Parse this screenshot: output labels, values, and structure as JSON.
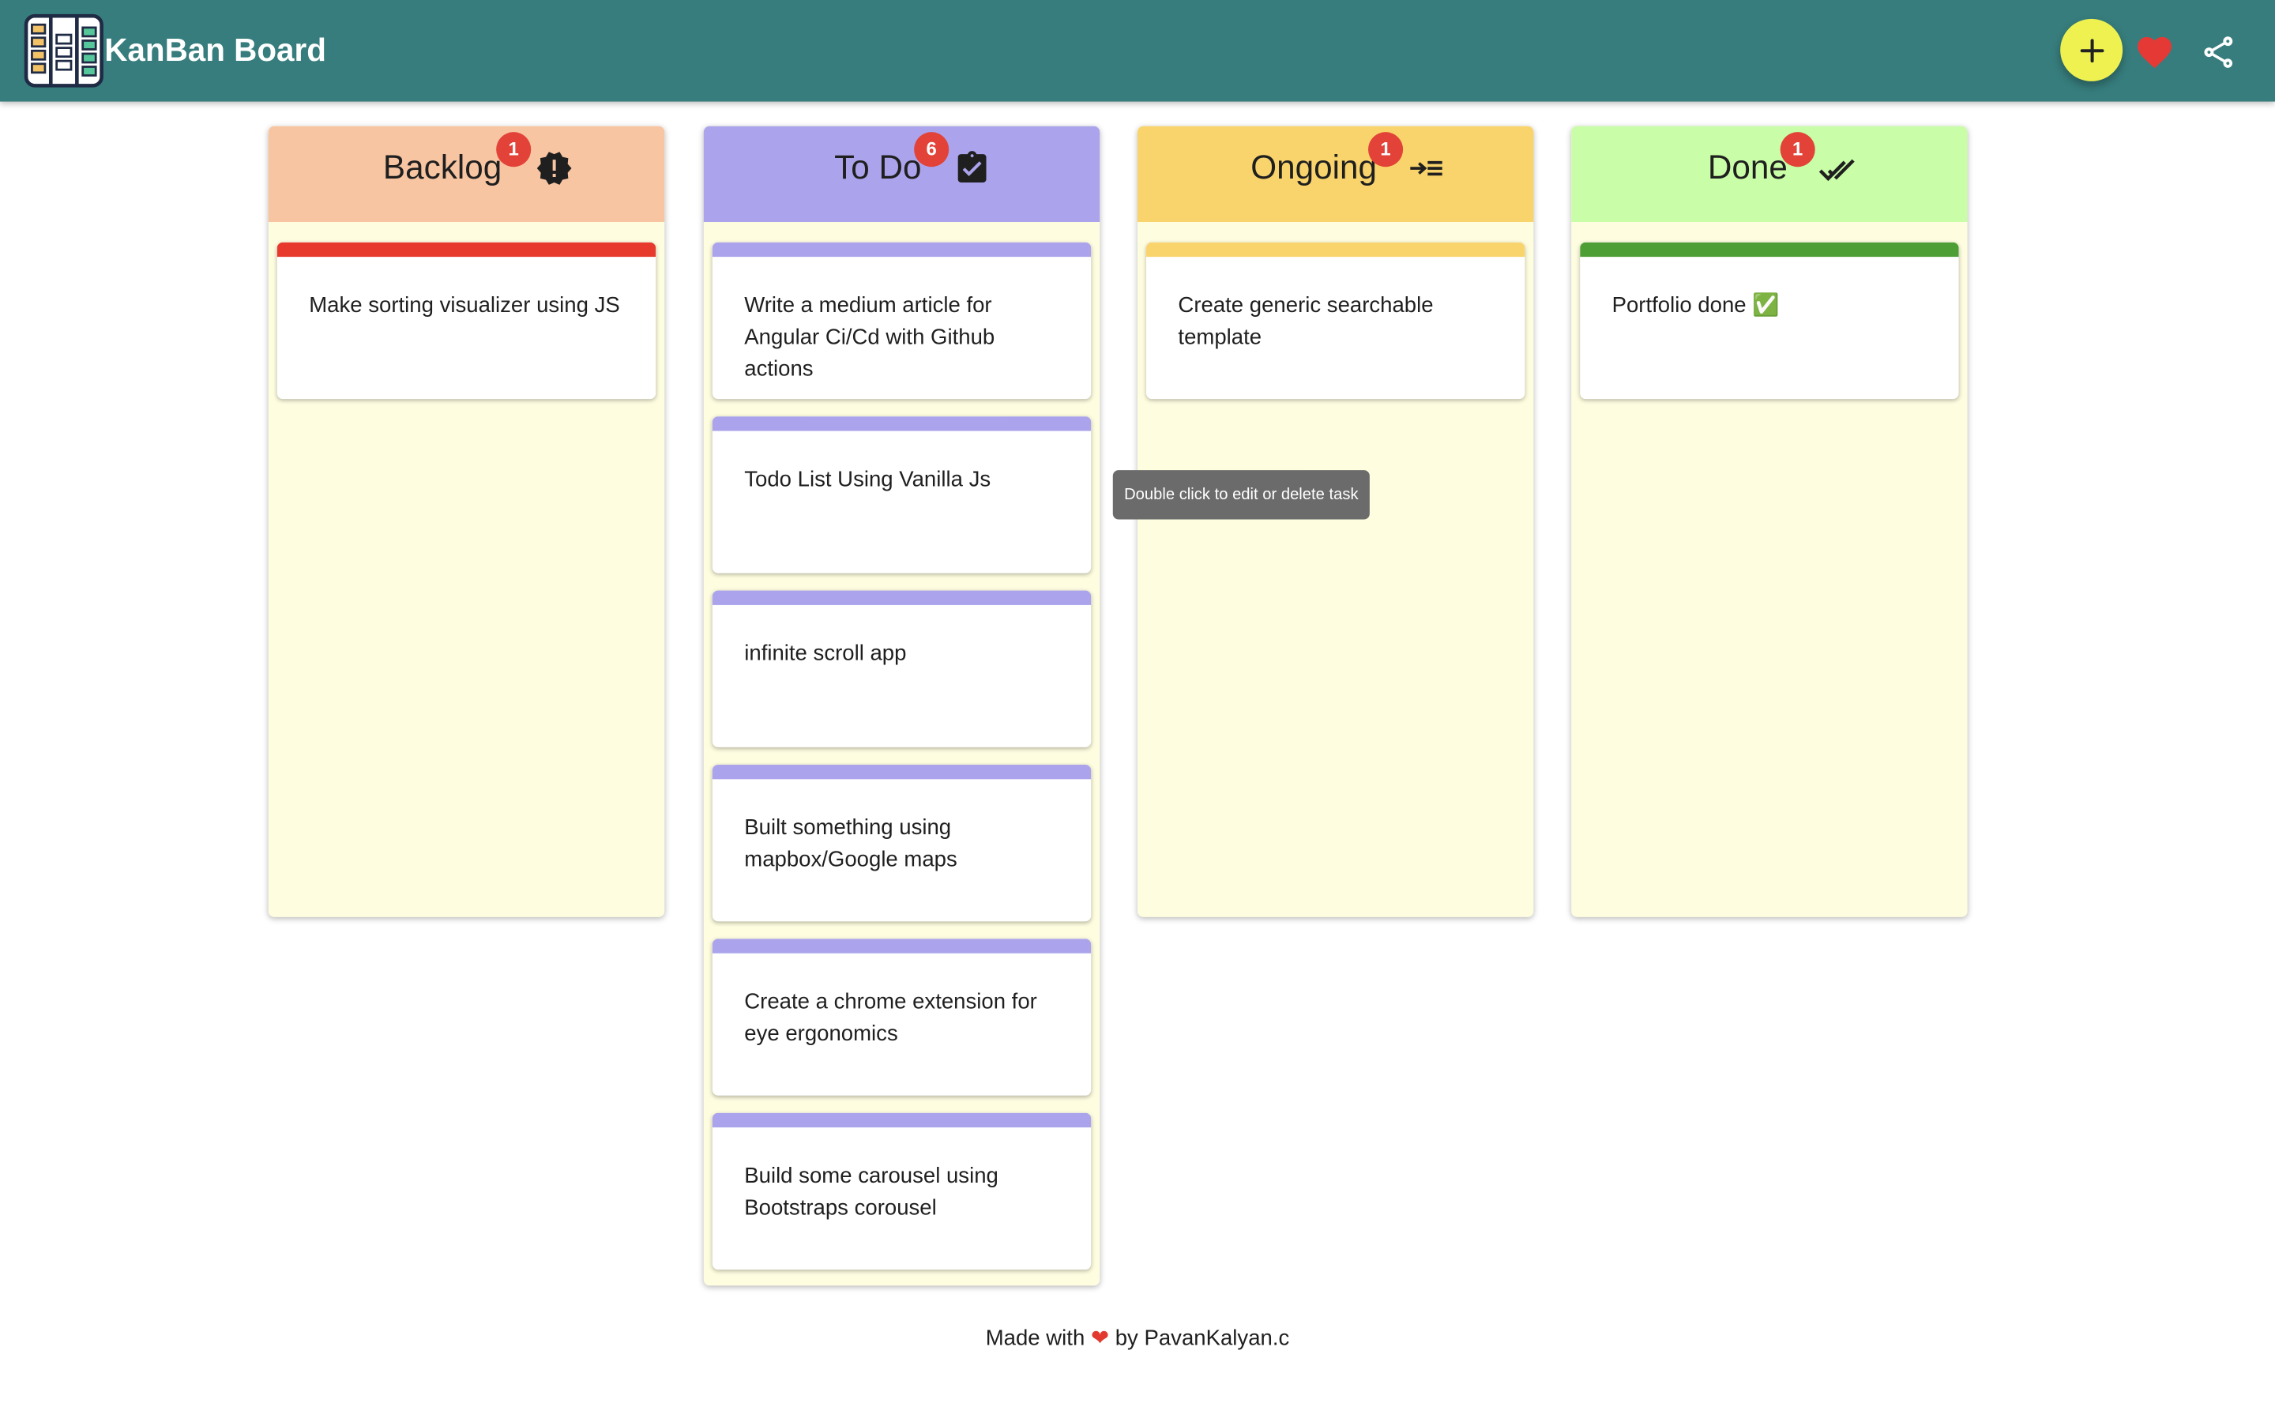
{
  "app": {
    "title": "KanBan Board",
    "logo_icon": "kanban-board-logo-icon"
  },
  "toolbar": {
    "add_icon": "plus-icon",
    "heart_icon": "heart-icon",
    "share_icon": "share-icon",
    "colors": {
      "background": "#377d7d",
      "fab": "#eef150",
      "heart": "#e53935"
    }
  },
  "columns": [
    {
      "title": "Backlog",
      "count": "1",
      "icon": "new-releases-alert-icon",
      "header_color": "#f8c5a2",
      "card_color": "#e73a2d",
      "cards": [
        {
          "text": "Make sorting visualizer using JS"
        }
      ]
    },
    {
      "title": "To Do",
      "count": "6",
      "icon": "assignment-turned-in-icon",
      "header_color": "#aba4ec",
      "card_color": "#aba4ec",
      "cards": [
        {
          "text": "Write a medium article for Angular Ci/Cd with Github actions"
        },
        {
          "text": "Todo List Using Vanilla Js"
        },
        {
          "text": "infinite scroll app"
        },
        {
          "text": "Built something using mapbox/Google maps"
        },
        {
          "text": "Create a chrome extension for eye ergonomics"
        },
        {
          "text": "Build some carousel using Bootstraps corousel"
        }
      ]
    },
    {
      "title": "Ongoing",
      "count": "1",
      "icon": "low-priority-arrow-list-icon",
      "header_color": "#f9d46c",
      "card_color": "#f9d46c",
      "cards": [
        {
          "text": "Create generic searchable template"
        }
      ]
    },
    {
      "title": "Done",
      "count": "1",
      "icon": "double-check-icon",
      "header_color": "#c9fda7",
      "card_color": "#4e9e36",
      "cards": [
        {
          "text": "Portfolio done ✅"
        }
      ]
    }
  ],
  "tooltip": {
    "text": "Double click to edit or delete task"
  },
  "footer": {
    "prefix": "Made with",
    "heart": "❤",
    "suffix": "by PavanKalyan.c"
  }
}
